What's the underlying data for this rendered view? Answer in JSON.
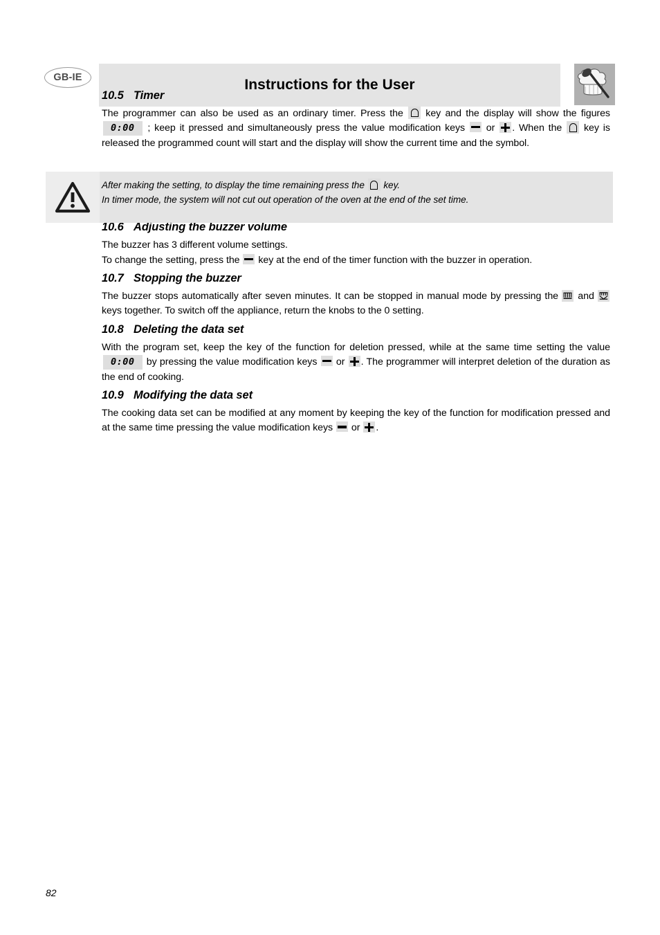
{
  "header": {
    "lang_badge": "GB-IE",
    "title": "Instructions for the User",
    "icon_name": "chef-hat-spoon-icon"
  },
  "sections": [
    {
      "number": "10.5",
      "title": "Timer",
      "paragraph_parts": {
        "p1_a": "The programmer can also be used as an ordinary timer. Press the",
        "p1_b": "key and the display will show the figures",
        "p1_lcd": "0:00",
        "p1_c": "; keep it pressed and simultaneously press the value modification keys",
        "p1_or": "or",
        "p1_d": ". When the",
        "p1_e": "key is released the programmed count will start and the display will show the current time and the symbol."
      }
    },
    {
      "number": "10.6",
      "title": "Adjusting the buzzer volume",
      "paragraph_parts": {
        "p1": "The buzzer has 3 different volume settings.",
        "p2_a": "To change the setting, press the",
        "p2_b": "key at the end of the timer function with the buzzer in operation."
      }
    },
    {
      "number": "10.7",
      "title": "Stopping the buzzer",
      "paragraph_parts": {
        "p1_a": "The buzzer stops automatically after seven minutes. It can be stopped in manual mode by pressing the",
        "p1_and": "and",
        "p1_b": "keys together. To switch off the appliance, return the knobs to the 0 setting."
      }
    },
    {
      "number": "10.8",
      "title": "Deleting the data set",
      "paragraph_parts": {
        "p1_a": "With the program set, keep the key of the function for deletion pressed, while at the same time setting the value",
        "p1_lcd": "0:00",
        "p1_b": "by pressing the value modification keys",
        "p1_or": "or",
        "p1_c": ". The programmer will interpret deletion of the duration as the end of cooking."
      }
    },
    {
      "number": "10.9",
      "title": "Modifying the data set",
      "paragraph_parts": {
        "p1_a": "The cooking data set can be modified at any moment by keeping the key of the function for modification pressed and at the same time pressing the value modification keys",
        "p1_or": "or",
        "p1_b": "."
      }
    }
  ],
  "warning": {
    "icon_name": "warning-triangle-icon",
    "line1_a": "After making the setting, to display the time remaining press the",
    "line1_b": "key.",
    "line2": "In timer mode, the system will not cut out operation of the oven at the end of the set time."
  },
  "footer": {
    "page_number": "82"
  },
  "colors": {
    "header_bar_bg": "#e4e4e4",
    "warning_bg": "#e4e4e4",
    "warning_icon_bg": "#ededed",
    "key_bg": "#dedede",
    "icon_box_bg": "#b0b0b0",
    "badge_stroke": "#9a9a9a"
  }
}
